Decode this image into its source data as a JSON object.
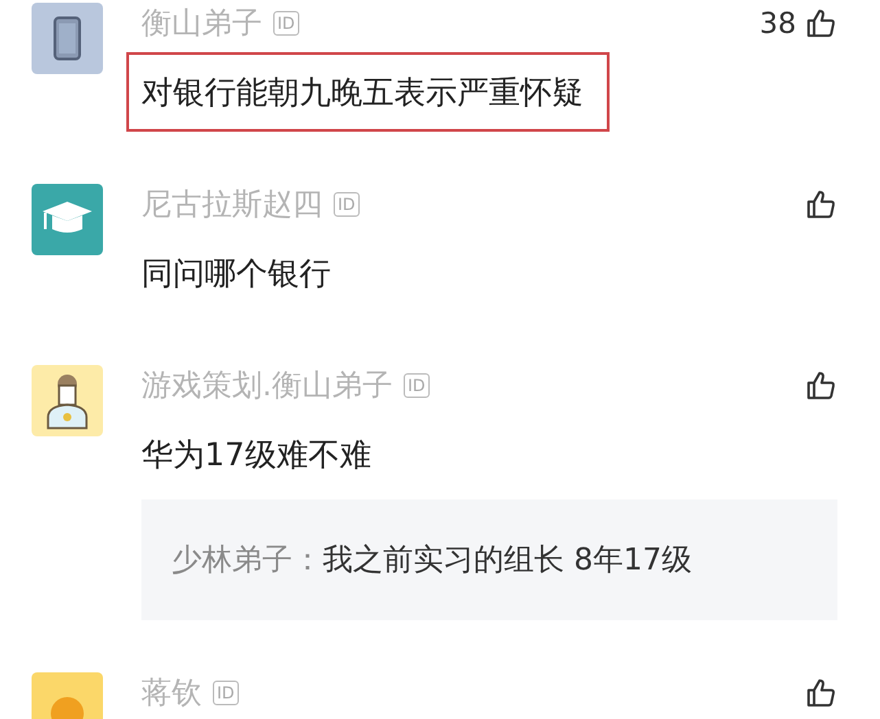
{
  "comments": [
    {
      "kind": "phone",
      "name": "衡山弟子",
      "id_badge": "ID",
      "likes": "38",
      "text": "对银行能朝九晚五表示严重怀疑",
      "highlighted": true
    },
    {
      "kind": "cap",
      "name": "尼古拉斯赵四",
      "id_badge": "ID",
      "text": "同问哪个银行",
      "highlighted": false
    },
    {
      "kind": "person",
      "name": "游戏策划.衡山弟子",
      "id_badge": "ID",
      "text": "华为17级难不难",
      "highlighted": false,
      "reply": {
        "author": "少林弟子：",
        "text": "我之前实习的组长 8年17级"
      }
    },
    {
      "kind": "figure",
      "name": "蒋钦",
      "id_badge": "ID"
    }
  ]
}
